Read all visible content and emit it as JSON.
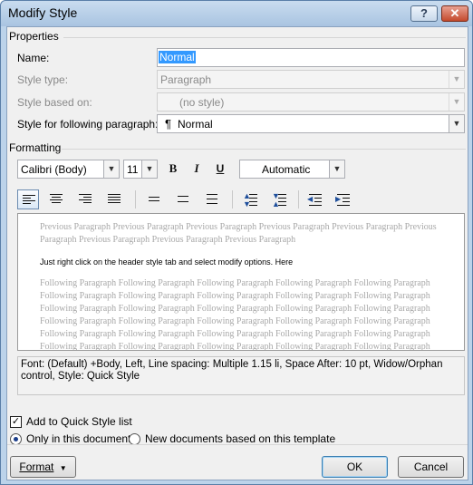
{
  "window": {
    "title": "Modify Style",
    "help_label": "?",
    "close_label": "✕"
  },
  "properties": {
    "heading": "Properties",
    "name_label": "Name:",
    "name_value": "Normal",
    "style_type_label": "Style type:",
    "style_type_value": "Paragraph",
    "based_on_label": "Style based on:",
    "based_on_value": "(no style)",
    "following_label": "Style for following paragraph:",
    "following_value": "Normal",
    "following_icon": "¶"
  },
  "formatting": {
    "heading": "Formatting",
    "font": "Calibri (Body)",
    "size": "11",
    "bold_label": "B",
    "italic_label": "I",
    "underline_label": "U",
    "color": "Automatic"
  },
  "preview": {
    "previous_text": "Previous Paragraph Previous Paragraph Previous Paragraph Previous Paragraph Previous Paragraph Previous Paragraph Previous Paragraph Previous Paragraph Previous Paragraph",
    "sample_text": "Just right click on the header style tab and select modify options. Here",
    "following_lines": [
      "Following Paragraph Following Paragraph Following Paragraph Following Paragraph Following Paragraph",
      "Following Paragraph Following Paragraph Following Paragraph Following Paragraph Following Paragraph",
      "Following Paragraph Following Paragraph Following Paragraph Following Paragraph Following Paragraph",
      "Following Paragraph Following Paragraph Following Paragraph Following Paragraph Following Paragraph",
      "Following Paragraph Following Paragraph Following Paragraph Following Paragraph Following Paragraph",
      "Following Paragraph Following Paragraph Following Paragraph Following Paragraph Following Paragraph"
    ]
  },
  "description": "Font: (Default) +Body, Left, Line spacing:  Multiple 1.15 li, Space After:  10 pt, Widow/Orphan control, Style: Quick Style",
  "options": {
    "add_quick_style_label": "Add to Quick Style list",
    "add_quick_style_checked": true,
    "only_doc_label": "Only in this document",
    "new_docs_label": "New documents based on this template",
    "selected_scope": "Only in this document"
  },
  "buttons": {
    "format": "Format",
    "ok": "OK",
    "cancel": "Cancel"
  }
}
